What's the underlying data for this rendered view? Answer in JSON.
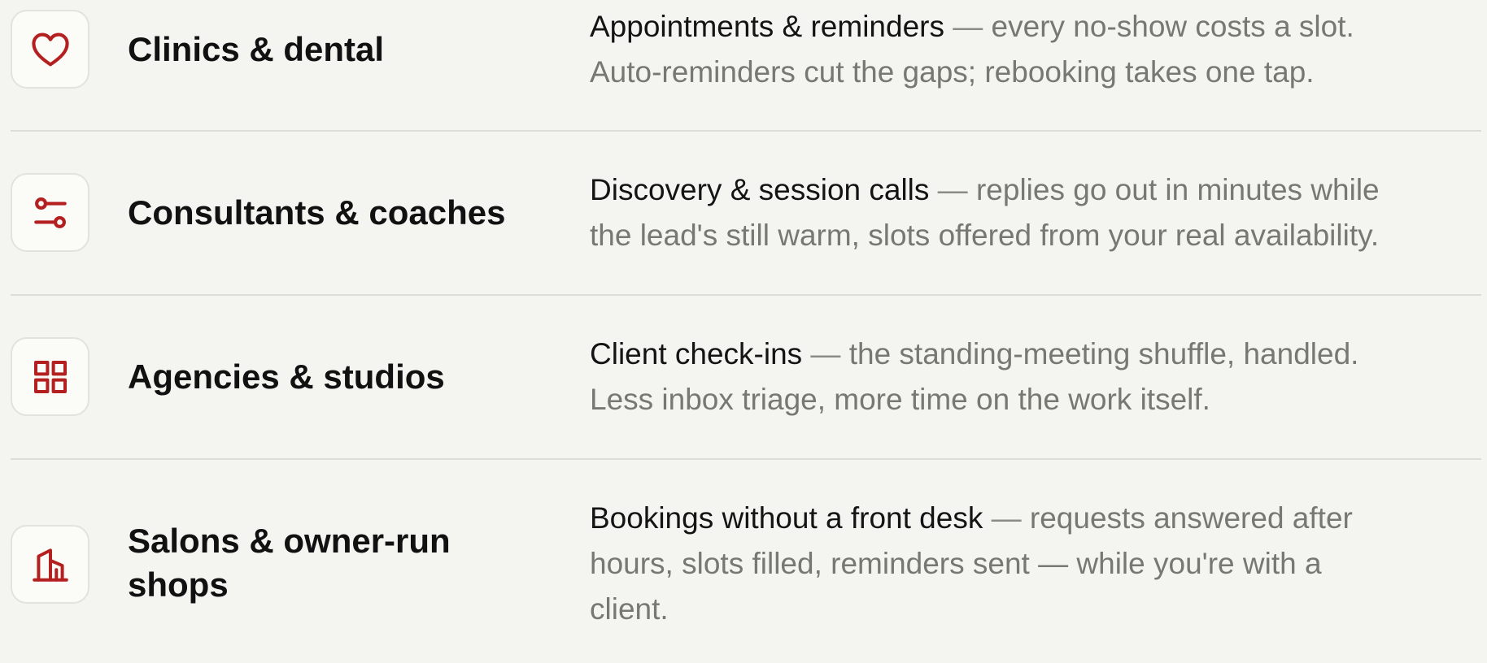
{
  "rows": [
    {
      "icon": "heart-icon",
      "title": "Clinics & dental",
      "lead": "Appointments & reminders",
      "dash": " — ",
      "line1": "every no-show costs a slot.",
      "line2": "Auto-reminders cut the gaps; rebooking takes one tap."
    },
    {
      "icon": "sliders-icon",
      "title": "Consultants & coaches",
      "lead": "Discovery & session calls",
      "dash": " — ",
      "line1": "replies go out in minutes while",
      "line2": "the lead's still warm, slots offered from your real availability."
    },
    {
      "icon": "grid-icon",
      "title": "Agencies & studios",
      "lead": "Client check-ins",
      "dash": " — ",
      "line1": "the standing-meeting shuffle, handled.",
      "line2": "Less inbox triage, more time on the work itself."
    },
    {
      "icon": "storefront-icon",
      "title_line1": "Salons & owner-run",
      "title_line2": "shops",
      "lead": "Bookings without a front desk",
      "dash": " — ",
      "line1": "requests answered after",
      "line2": "hours, slots filled, reminders sent — while you're with a",
      "line3": "client."
    }
  ],
  "colors": {
    "background": "#f4f4f0",
    "accent": "#b3201f",
    "heading": "#111111",
    "muted": "#777773",
    "divider": "#dcdcd8"
  }
}
